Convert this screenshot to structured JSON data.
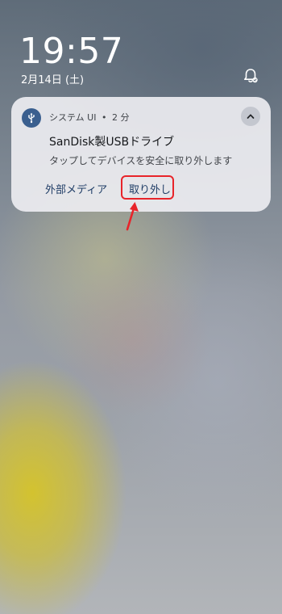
{
  "lockscreen": {
    "time": "19:57",
    "date": "2月14日 (土)",
    "bell_icon": "notifications-off-icon"
  },
  "notification": {
    "app_icon": "usb-icon",
    "app_name": "システム UI",
    "separator": "•",
    "age": "2 分",
    "collapse_icon": "chevron-up-icon",
    "title": "SanDisk製USBドライブ",
    "body": "タップしてデバイスを安全に取り外します",
    "actions": [
      {
        "label": "外部メディア"
      },
      {
        "label": "取り外し"
      }
    ]
  },
  "annotation": {
    "color": "#e8242a",
    "highlight_target": "取り外し"
  }
}
